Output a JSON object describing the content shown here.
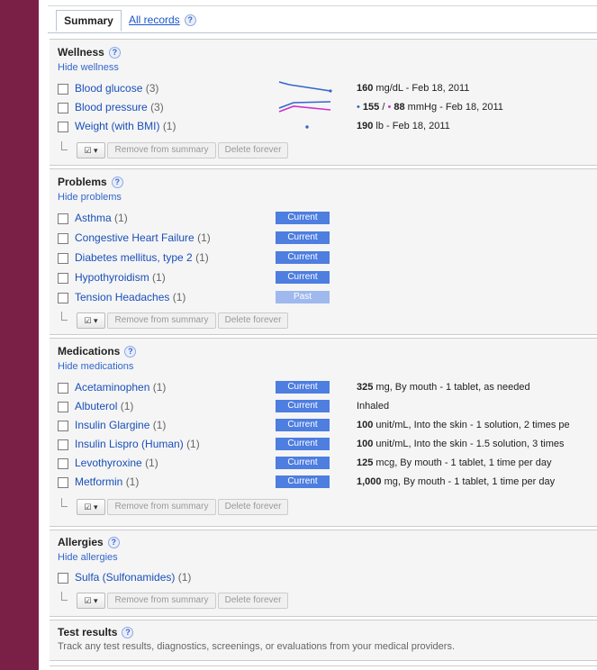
{
  "tabs": {
    "summary": "Summary",
    "all_records": "All records",
    "help": "?"
  },
  "common": {
    "remove": "Remove from summary",
    "delete": "Delete forever",
    "select": "☑ ▾"
  },
  "wellness": {
    "title": "Wellness",
    "hide": "Hide wellness",
    "items": [
      {
        "name": "Blood glucose",
        "count": "(3)",
        "value": "160",
        "unit": " mg/dL - Feb 18, 2011"
      },
      {
        "name": "Blood pressure",
        "count": "(3)",
        "bullet1": "• ",
        "sys": "155",
        "sep": " / ",
        "bullet2": "• ",
        "dia": "88",
        "unit": " mmHg - Feb 18, 2011"
      },
      {
        "name": "Weight (with BMI)",
        "count": "(1)",
        "value": "190",
        "unit": " lb - Feb 18, 2011"
      }
    ],
    "colors": {
      "line1": "#3366cc",
      "line2": "#cc33cc"
    }
  },
  "problems": {
    "title": "Problems",
    "hide": "Hide problems",
    "items": [
      {
        "name": "Asthma",
        "count": "(1)",
        "status": "Current"
      },
      {
        "name": "Congestive Heart Failure",
        "count": "(1)",
        "status": "Current"
      },
      {
        "name": "Diabetes mellitus, type 2",
        "count": "(1)",
        "status": "Current"
      },
      {
        "name": "Hypothyroidism",
        "count": "(1)",
        "status": "Current"
      },
      {
        "name": "Tension Headaches",
        "count": "(1)",
        "status": "Past"
      }
    ]
  },
  "medications": {
    "title": "Medications",
    "hide": "Hide medications",
    "items": [
      {
        "name": "Acetaminophen",
        "count": "(1)",
        "status": "Current",
        "dose": "325",
        "detail": " mg, By mouth - 1 tablet, as needed"
      },
      {
        "name": "Albuterol",
        "count": "(1)",
        "status": "Current",
        "dose": "",
        "detail": "Inhaled"
      },
      {
        "name": "Insulin Glargine",
        "count": "(1)",
        "status": "Current",
        "dose": "100",
        "detail": " unit/mL, Into the skin - 1 solution, 2 times pe"
      },
      {
        "name": "Insulin Lispro (Human)",
        "count": "(1)",
        "status": "Current",
        "dose": "100",
        "detail": " unit/mL, Into the skin - 1.5 solution, 3 times"
      },
      {
        "name": "Levothyroxine",
        "count": "(1)",
        "status": "Current",
        "dose": "125",
        "detail": " mcg, By mouth - 1 tablet, 1 time per day"
      },
      {
        "name": "Metformin",
        "count": "(1)",
        "status": "Current",
        "dose": "1,000",
        "detail": " mg, By mouth - 1 tablet, 1 time per day"
      }
    ]
  },
  "allergies": {
    "title": "Allergies",
    "hide": "Hide allergies",
    "items": [
      {
        "name": "Sulfa (Sulfonamides)",
        "count": "(1)"
      }
    ]
  },
  "test_results": {
    "title": "Test results",
    "description": "Track any test results, diagnostics, screenings, or evaluations from your medical providers."
  },
  "colors": {
    "accent_bar": "#7a1f45",
    "badge_current": "#4d7ee0",
    "badge_past": "#9fb8ee",
    "link": "#1a4fb8"
  }
}
